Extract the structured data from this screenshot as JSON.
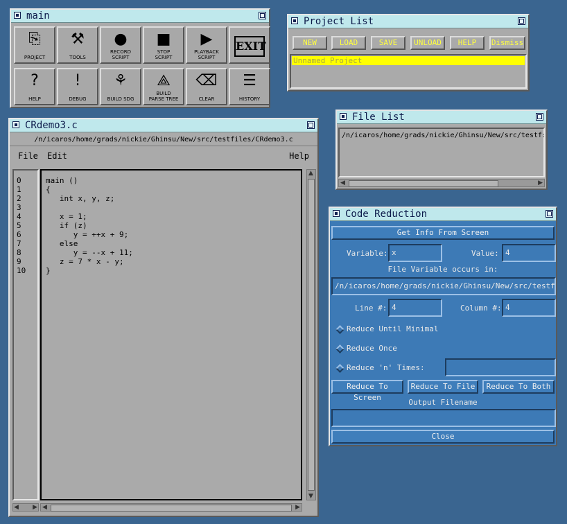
{
  "main_window": {
    "title": "main",
    "tools": [
      {
        "label1": "PROJECT",
        "label2": "",
        "icon": "project-icon",
        "glyph": "⎘"
      },
      {
        "label1": "TOOLS",
        "label2": "",
        "icon": "tools-icon",
        "glyph": "⚒"
      },
      {
        "label1": "RECORD",
        "label2": "SCRIPT",
        "icon": "record-icon",
        "glyph": "●"
      },
      {
        "label1": "STOP",
        "label2": "SCRIPT",
        "icon": "stop-icon",
        "glyph": "■"
      },
      {
        "label1": "PLAYBACK",
        "label2": "SCRIPT",
        "icon": "playback-icon",
        "glyph": "▶"
      },
      {
        "label1": "",
        "label2": "",
        "icon": "exit-icon",
        "glyph": "EXIT"
      },
      {
        "label1": "HELP",
        "label2": "",
        "icon": "help-icon",
        "glyph": "?"
      },
      {
        "label1": "DEBUG",
        "label2": "",
        "icon": "debug-icon",
        "glyph": "!"
      },
      {
        "label1": "BUILD SDG",
        "label2": "",
        "icon": "build-sdg-icon",
        "glyph": "⚘"
      },
      {
        "label1": "BUILD",
        "label2": "PARSE TREE",
        "icon": "parse-tree-icon",
        "glyph": "⟁"
      },
      {
        "label1": "CLEAR",
        "label2": "",
        "icon": "eraser-icon",
        "glyph": "⌫"
      },
      {
        "label1": "HISTORY",
        "label2": "",
        "icon": "books-icon",
        "glyph": "☰"
      }
    ]
  },
  "project_list": {
    "title": "Project List",
    "buttons": [
      "NEW",
      "LOAD",
      "SAVE",
      "UNLOAD",
      "HELP",
      "Dismiss"
    ],
    "items": [
      "Unnamed Project"
    ]
  },
  "file_list": {
    "title": "File List",
    "items": [
      "/n/icaros/home/grads/nickie/Ghinsu/New/src/testf:"
    ]
  },
  "editor": {
    "title": "CRdemo3.c",
    "path": "/n/icaros/home/grads/nickie/Ghinsu/New/src/testfiles/CRdemo3.c",
    "menu": {
      "file": "File",
      "edit": "Edit",
      "help": "Help"
    },
    "line_numbers": [
      "0",
      "1",
      "2",
      "3",
      "4",
      "5",
      "6",
      "7",
      "8",
      "9",
      "10"
    ],
    "lines": [
      "main ()",
      "{",
      "   int x, y, z;",
      "",
      "   x = 1;",
      "   if (z)",
      "      y = ++x + 9;",
      "   else",
      "      y = --x + 11;",
      "   z = 7 * x - y;",
      "}"
    ]
  },
  "code_reduction": {
    "title": "Code Reduction",
    "get_info": "Get Info From Screen",
    "variable_label": "Variable:",
    "variable_value": "x",
    "value_label": "Value:",
    "value_value": "4",
    "occurs_label": "File Variable occurs in:",
    "occurs_value": "/n/icaros/home/grads/nickie/Ghinsu/New/src/testfiles",
    "line_label": "Line #:",
    "line_value": "4",
    "column_label": "Column #:",
    "column_value": "4",
    "reduce_minimal": "Reduce Until Minimal",
    "reduce_once": "Reduce Once",
    "reduce_n": "Reduce 'n' Times:",
    "n_value": "",
    "reduce_screen": "Reduce To Screen",
    "reduce_file": "Reduce To File",
    "reduce_both": "Reduce To Both",
    "output_label": "Output Filename",
    "output_value": "",
    "close": "Close"
  },
  "colors": {
    "desktop": "#3a6590",
    "titlebar": "#bfe8ec",
    "selection": "#ffff00",
    "accent_text": "#ffff40",
    "panel_blue": "#3d7ab6"
  }
}
